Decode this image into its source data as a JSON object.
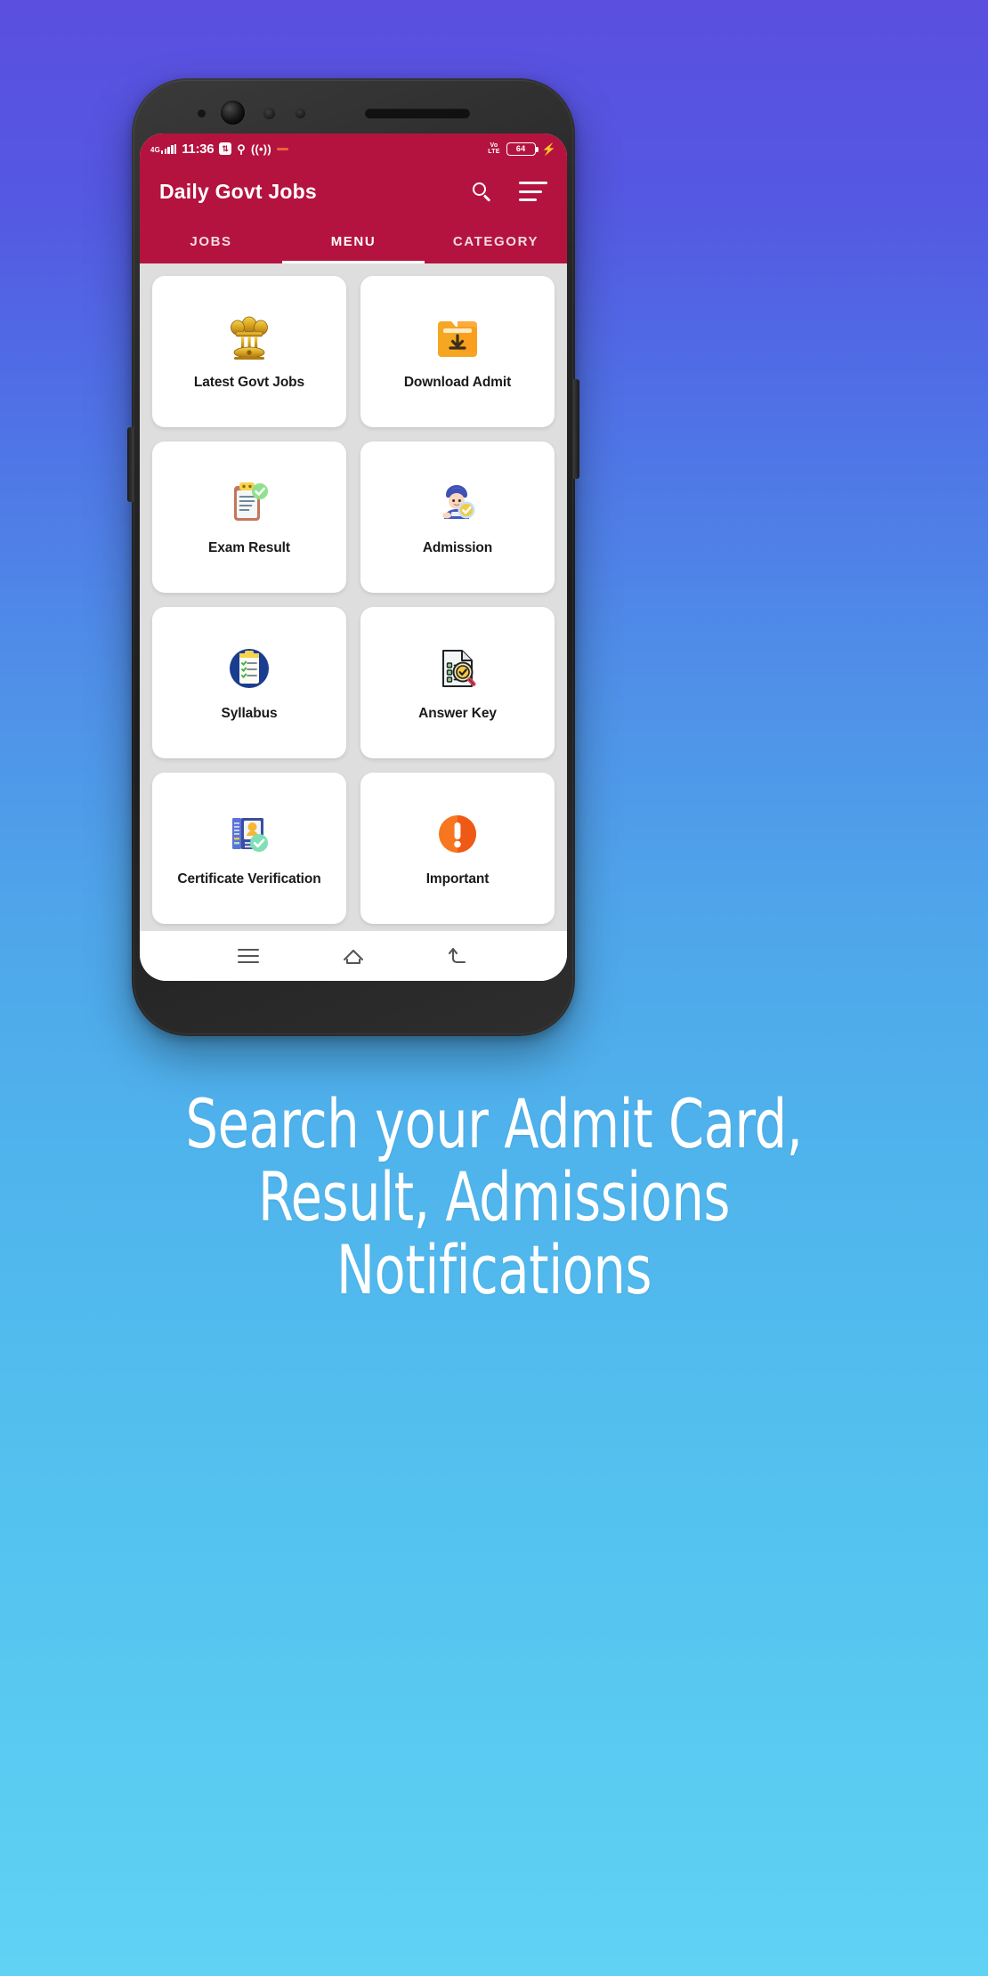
{
  "statusbar": {
    "network_label": "4G",
    "time": "11:36",
    "hotspot_icon": "hotspot-icon",
    "usb_icon": "usb-icon",
    "cast_icon": "wireless-cast-icon",
    "dnd_icon": "dash-icon",
    "volte_line1": "Vo",
    "volte_line2": "LTE",
    "battery_percent": "64",
    "charging_icon": "⚡"
  },
  "appbar": {
    "title": "Daily Govt Jobs",
    "search_icon": "search-icon",
    "menu_icon": "hamburger-menu-icon"
  },
  "tabs": [
    {
      "label": "JOBS",
      "active": false
    },
    {
      "label": "MENU",
      "active": true
    },
    {
      "label": "CATEGORY",
      "active": false
    }
  ],
  "menu_items": [
    {
      "label": "Latest Govt Jobs",
      "icon": "india-national-emblem-icon"
    },
    {
      "label": "Download Admit",
      "icon": "download-folder-icon"
    },
    {
      "label": "Exam Result",
      "icon": "clipboard-check-icon"
    },
    {
      "label": "Admission",
      "icon": "student-verified-icon"
    },
    {
      "label": "Syllabus",
      "icon": "checklist-clipboard-icon"
    },
    {
      "label": "Answer Key",
      "icon": "document-magnifier-check-icon"
    },
    {
      "label": "Certificate Verification",
      "icon": "certificate-verified-icon"
    },
    {
      "label": "Important",
      "icon": "exclamation-circle-icon"
    }
  ],
  "navbar": {
    "recent_icon": "recent-apps-icon",
    "home_icon": "home-icon",
    "back_icon": "back-icon"
  },
  "caption": {
    "line1": "Search your Admit Card,",
    "line2": "Result, Admissions",
    "line3": "Notifications"
  },
  "colors": {
    "brand": "#b5133f",
    "bg_top": "#5b4fe0",
    "bg_bottom": "#60d2f4",
    "card": "#ffffff",
    "content_bg": "#dedede"
  }
}
